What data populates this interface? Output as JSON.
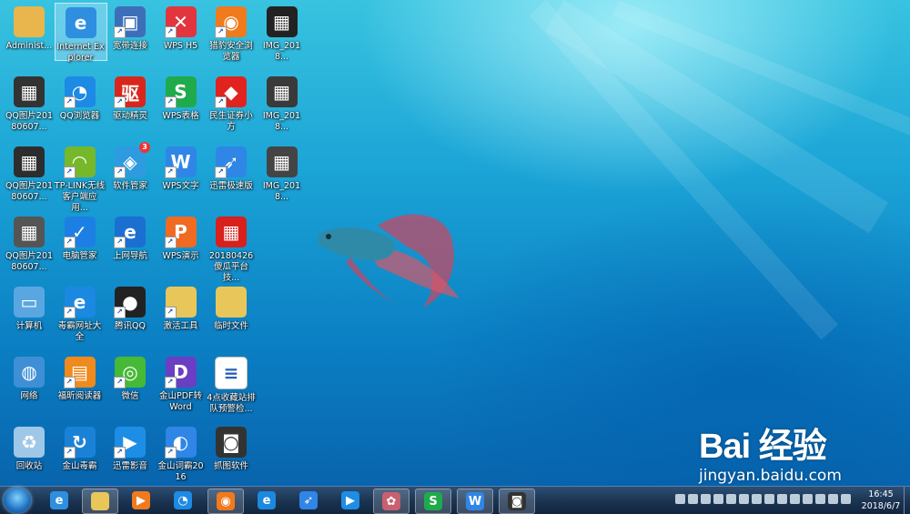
{
  "desktop": {
    "icons": [
      {
        "id": "administrator",
        "label": "Administ...",
        "glyph": "folder-user-icon",
        "color": "#e8b64c",
        "col": 0,
        "row": 0,
        "shortcut": false
      },
      {
        "id": "internet-explorer",
        "label": "Internet Explorer",
        "glyph": "ie-icon",
        "color": "#2e8fe0",
        "col": 1,
        "row": 0,
        "shortcut": false,
        "selected": true
      },
      {
        "id": "broadband",
        "label": "宽带连接",
        "glyph": "network-computer-icon",
        "color": "#3d6fb8",
        "col": 2,
        "row": 0,
        "shortcut": true
      },
      {
        "id": "wps-h5",
        "label": "WPS H5",
        "glyph": "wps-h5-icon",
        "color": "#e2353e",
        "col": 3,
        "row": 0,
        "shortcut": true
      },
      {
        "id": "cheetah-browser",
        "label": "猎豹安全浏览器",
        "glyph": "cheetah-browser-icon",
        "color": "#f07a1c",
        "col": 4,
        "row": 0,
        "shortcut": true
      },
      {
        "id": "img-2018-a",
        "label": "IMG_2018...",
        "glyph": "image-thumb-icon",
        "color": "#222222",
        "col": 5,
        "row": 0,
        "shortcut": false
      },
      {
        "id": "qq-pic-1",
        "label": "QQ图片20180607...",
        "glyph": "image-thumb-icon",
        "color": "#333333",
        "col": 0,
        "row": 1,
        "shortcut": false
      },
      {
        "id": "qq-browser",
        "label": "QQ浏览器",
        "glyph": "qq-browser-icon",
        "color": "#1d8ae5",
        "col": 1,
        "row": 1,
        "shortcut": true
      },
      {
        "id": "driver-genius",
        "label": "驱动精灵",
        "glyph": "driver-genius-icon",
        "color": "#d9261c",
        "col": 2,
        "row": 1,
        "shortcut": true
      },
      {
        "id": "wps-sheet",
        "label": "WPS表格",
        "glyph": "wps-sheet-icon",
        "color": "#1faa4c",
        "col": 3,
        "row": 1,
        "shortcut": true
      },
      {
        "id": "minsheng",
        "label": "民生证券小方",
        "glyph": "minsheng-icon",
        "color": "#e0231f",
        "col": 4,
        "row": 1,
        "shortcut": true
      },
      {
        "id": "img-2018-b",
        "label": "IMG_2018...",
        "glyph": "image-thumb-icon",
        "color": "#3a3a3a",
        "col": 5,
        "row": 1,
        "shortcut": false
      },
      {
        "id": "qq-pic-2",
        "label": "QQ图片20180607...",
        "glyph": "image-thumb-icon",
        "color": "#2d2d2d",
        "col": 0,
        "row": 2,
        "shortcut": false
      },
      {
        "id": "tplink",
        "label": "TP-LINK无线客户端应用...",
        "glyph": "wifi-icon",
        "color": "#77b82a",
        "col": 1,
        "row": 2,
        "shortcut": true
      },
      {
        "id": "software-manager",
        "label": "软件管家",
        "glyph": "software-manager-icon",
        "color": "#2e9be0",
        "col": 2,
        "row": 2,
        "shortcut": true,
        "badge": "3"
      },
      {
        "id": "wps-writer",
        "label": "WPS文字",
        "glyph": "wps-writer-icon",
        "color": "#2f86e6",
        "col": 3,
        "row": 2,
        "shortcut": true
      },
      {
        "id": "xunlei-speed",
        "label": "迅雷极速版",
        "glyph": "xunlei-bird-icon",
        "color": "#2f86e6",
        "col": 4,
        "row": 2,
        "shortcut": true
      },
      {
        "id": "img-2018-c",
        "label": "IMG_2018...",
        "glyph": "image-thumb-icon",
        "color": "#444444",
        "col": 5,
        "row": 2,
        "shortcut": false
      },
      {
        "id": "qq-pic-3",
        "label": "QQ图片20180607...",
        "glyph": "image-thumb-icon",
        "color": "#555555",
        "col": 0,
        "row": 3,
        "shortcut": false
      },
      {
        "id": "pc-manager",
        "label": "电脑管家",
        "glyph": "shield-icon",
        "color": "#1c7fe3",
        "col": 1,
        "row": 3,
        "shortcut": true
      },
      {
        "id": "web-nav",
        "label": "上网导航",
        "glyph": "ie-icon",
        "color": "#1b6fd1",
        "col": 2,
        "row": 3,
        "shortcut": true
      },
      {
        "id": "wps-present",
        "label": "WPS演示",
        "glyph": "wps-present-icon",
        "color": "#f06a22",
        "col": 3,
        "row": 3,
        "shortcut": true
      },
      {
        "id": "file-20180426",
        "label": "20180426傻瓜平台技...",
        "glyph": "image-thumb-icon",
        "color": "#d8201c",
        "col": 4,
        "row": 3,
        "shortcut": false
      },
      {
        "id": "computer",
        "label": "计算机",
        "glyph": "computer-icon",
        "color": "#5aa6e0",
        "col": 0,
        "row": 4,
        "shortcut": false
      },
      {
        "id": "duba-nav",
        "label": "毒霸网址大全",
        "glyph": "ie-icon",
        "color": "#1b89e0",
        "col": 1,
        "row": 4,
        "shortcut": true
      },
      {
        "id": "tencent-qq",
        "label": "腾讯QQ",
        "glyph": "qq-penguin-icon",
        "color": "#222222",
        "col": 2,
        "row": 4,
        "shortcut": true
      },
      {
        "id": "activate-tool",
        "label": "激活工具",
        "glyph": "folder-icon",
        "color": "#e9c65a",
        "col": 3,
        "row": 4,
        "shortcut": true
      },
      {
        "id": "temp-files",
        "label": "临时文件",
        "glyph": "folder-icon",
        "color": "#e9c65a",
        "col": 4,
        "row": 4,
        "shortcut": false
      },
      {
        "id": "network",
        "label": "网络",
        "glyph": "globe-network-icon",
        "color": "#3f8fd6",
        "col": 0,
        "row": 5,
        "shortcut": false
      },
      {
        "id": "foxit-reader",
        "label": "福昕阅读器",
        "glyph": "pdf-icon",
        "color": "#f08a1c",
        "col": 1,
        "row": 5,
        "shortcut": true
      },
      {
        "id": "wechat",
        "label": "微信",
        "glyph": "wechat-icon",
        "color": "#46b936",
        "col": 2,
        "row": 5,
        "shortcut": true
      },
      {
        "id": "kingsoft-pdf",
        "label": "金山PDF转Word",
        "glyph": "pdf-convert-icon",
        "color": "#6a3fc4",
        "col": 3,
        "row": 5,
        "shortcut": true
      },
      {
        "id": "doc-4dian",
        "label": "4点收藏站排队预警检...",
        "glyph": "word-doc-icon",
        "color": "#ffffff",
        "col": 4,
        "row": 5,
        "shortcut": false
      },
      {
        "id": "recycle-bin",
        "label": "回收站",
        "glyph": "recycle-bin-icon",
        "color": "#9fc7e8",
        "col": 0,
        "row": 6,
        "shortcut": false
      },
      {
        "id": "kingsoft-av",
        "label": "金山毒霸",
        "glyph": "kingsoft-av-icon",
        "color": "#1a82d6",
        "col": 1,
        "row": 6,
        "shortcut": true
      },
      {
        "id": "xunlei-video",
        "label": "迅雷影音",
        "glyph": "play-icon",
        "color": "#1e8de6",
        "col": 2,
        "row": 6,
        "shortcut": true
      },
      {
        "id": "kingsoft-dict",
        "label": "金山词霸2016",
        "glyph": "dictionary-icon",
        "color": "#2f86e6",
        "col": 3,
        "row": 6,
        "shortcut": true
      },
      {
        "id": "screenshot-tool",
        "label": "抓图软件",
        "glyph": "camera-icon",
        "color": "#333333",
        "col": 4,
        "row": 6,
        "shortcut": false
      }
    ]
  },
  "watermark": {
    "logo": "Bai 经验",
    "url": "jingyan.baidu.com"
  },
  "taskbar": {
    "items": [
      {
        "id": "ie",
        "glyph": "ie-icon",
        "color": "#2e8fe0",
        "open": false
      },
      {
        "id": "explorer",
        "glyph": "folder-icon",
        "color": "#e9c65a",
        "open": true
      },
      {
        "id": "media-player",
        "glyph": "play-icon",
        "color": "#f07a1c",
        "open": false
      },
      {
        "id": "qq-browser",
        "glyph": "qq-browser-icon",
        "color": "#1d8ae5",
        "open": false
      },
      {
        "id": "cheetah",
        "glyph": "cheetah-browser-icon",
        "color": "#f07a1c",
        "open": true
      },
      {
        "id": "ie-2",
        "glyph": "ie-icon",
        "color": "#1b89e0",
        "open": false
      },
      {
        "id": "xunlei",
        "glyph": "xunlei-bird-icon",
        "color": "#2f86e6",
        "open": false
      },
      {
        "id": "browser-blue",
        "glyph": "play-icon",
        "color": "#1e8de6",
        "open": false
      },
      {
        "id": "fish-app",
        "glyph": "fish-icon",
        "color": "#c86070",
        "open": true
      },
      {
        "id": "wps-s",
        "glyph": "wps-sheet-icon",
        "color": "#1faa4c",
        "open": true
      },
      {
        "id": "wps-w",
        "glyph": "wps-writer-icon",
        "color": "#2f86e6",
        "open": true
      },
      {
        "id": "camera",
        "glyph": "camera-icon",
        "color": "#333333",
        "open": true
      }
    ],
    "clock": {
      "time": "16:45",
      "date": "2018/6/7"
    }
  }
}
